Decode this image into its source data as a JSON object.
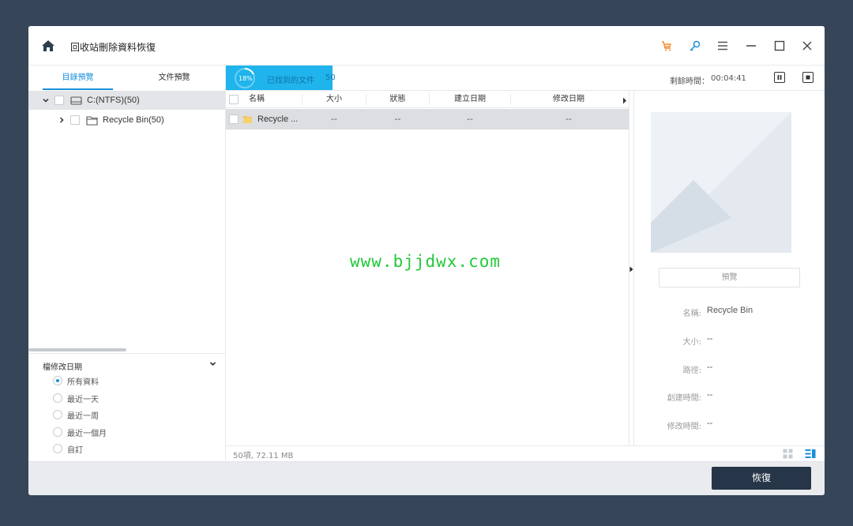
{
  "window": {
    "title": "回收站刪除資料恢復"
  },
  "toolbar": {
    "icons": [
      "cart-icon",
      "key-icon",
      "menu-icon",
      "minimize-icon",
      "maximize-icon",
      "close-icon"
    ],
    "cart_color": "#f08c2e",
    "key_color": "#1a8fd9"
  },
  "left_panel": {
    "tabs": [
      {
        "label": "目錄預覽",
        "active": true
      },
      {
        "label": "文件預覽",
        "active": false
      }
    ],
    "tree": [
      {
        "label": "C:(NTFS)(50)",
        "expanded": true,
        "selected": true
      },
      {
        "label": "Recycle Bin(50)",
        "expanded": false,
        "selected": false
      }
    ],
    "filter": {
      "title": "檔修改日期",
      "options": [
        {
          "label": "所有資料",
          "checked": true
        },
        {
          "label": "最近一天",
          "checked": false
        },
        {
          "label": "最近一周",
          "checked": false
        },
        {
          "label": "最近一個月",
          "checked": false
        },
        {
          "label": "自訂",
          "checked": false
        }
      ]
    }
  },
  "scan": {
    "progress_text": "18%",
    "progress_value": 0.18,
    "found_label": "已找到的文件",
    "found_count": "50",
    "remaining_label": "剩餘時間：",
    "remaining_value": "00:04:41",
    "accent_color": "#1fb4ec"
  },
  "table": {
    "columns": [
      "名稱",
      "大小",
      "狀態",
      "建立日期",
      "修改日期"
    ],
    "rows": [
      {
        "name": "Recycle ...",
        "size": "--",
        "status": "--",
        "created": "--",
        "modified": "--"
      }
    ]
  },
  "watermark": "www.bjjdwx.com",
  "status": {
    "summary": "50項, 72.11 MB"
  },
  "details": {
    "preview_button": "預覽",
    "properties": [
      {
        "label": "名稱:",
        "value": "Recycle Bin"
      },
      {
        "label": "大小:",
        "value": "--"
      },
      {
        "label": "路徑:",
        "value": "--"
      },
      {
        "label": "創建時間:",
        "value": "--"
      },
      {
        "label": "修改時間:",
        "value": "--"
      }
    ]
  },
  "footer": {
    "recover_button": "恢復",
    "recover_color": "#273548"
  }
}
